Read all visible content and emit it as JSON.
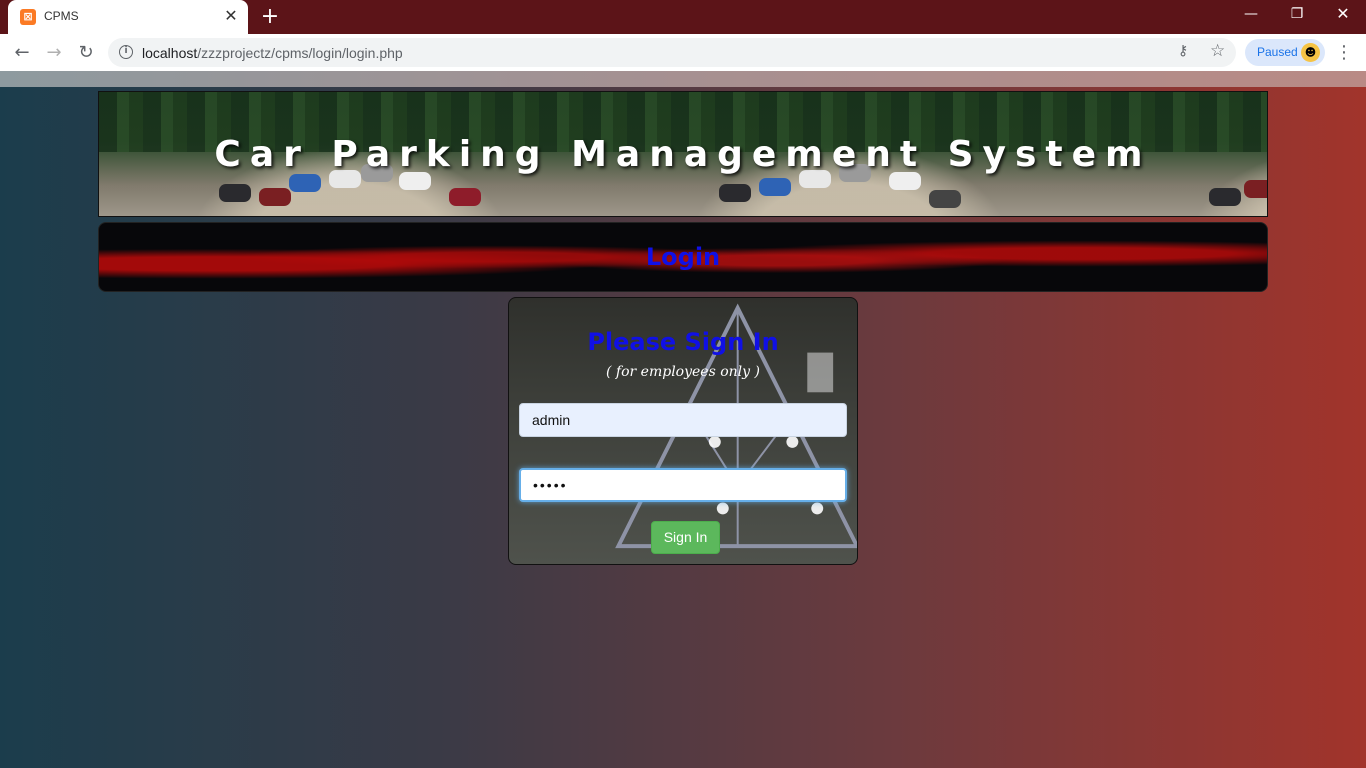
{
  "browser": {
    "tab_title": "CPMS",
    "favicon_glyph": "⊠",
    "url_host": "localhost",
    "url_path": "/zzzprojectz/cpms/login/login.php",
    "profile_status": "Paused",
    "accent_color": "#5c1418"
  },
  "page": {
    "banner_title": "Car Parking Management System",
    "section_title": "Login",
    "form": {
      "heading": "Please Sign In",
      "subheading": "( for employees only )",
      "username_value": "admin",
      "password_mask": "•••••",
      "submit_label": "Sign In"
    },
    "colors": {
      "heading_blue": "#1010e6",
      "button_green": "#5cb85c"
    }
  }
}
